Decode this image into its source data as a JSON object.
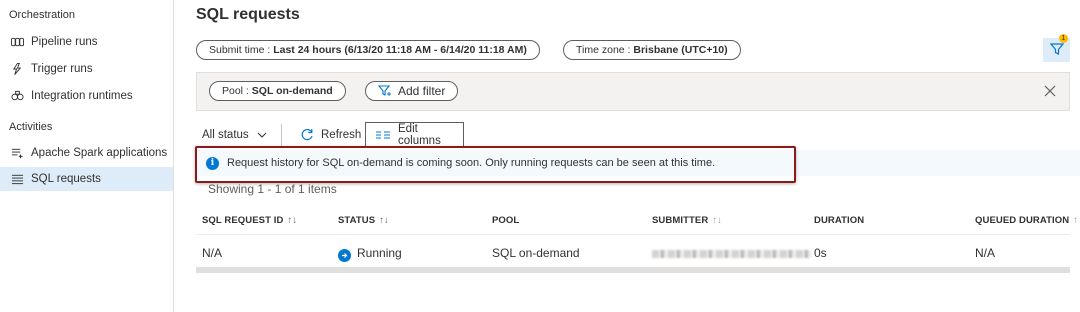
{
  "sidebar": {
    "orchestration_heading": "Orchestration",
    "orchestration_items": [
      {
        "label": "Pipeline runs",
        "icon": "pipeline-icon"
      },
      {
        "label": "Trigger runs",
        "icon": "trigger-icon"
      },
      {
        "label": "Integration runtimes",
        "icon": "integration-runtime-icon"
      }
    ],
    "activities_heading": "Activities",
    "activities_items": [
      {
        "label": "Apache Spark applications",
        "icon": "spark-icon"
      },
      {
        "label": "SQL requests",
        "icon": "sql-requests-icon",
        "active": true
      }
    ]
  },
  "page": {
    "title": "SQL requests"
  },
  "filters": {
    "submit_time_prefix": "Submit time : ",
    "submit_time_value": "Last 24 hours (6/13/20 11:18 AM - 6/14/20 11:18 AM)",
    "time_zone_prefix": "Time zone : ",
    "time_zone_value": "Brisbane (UTC+10)",
    "filter_badge_count": "1",
    "pool_prefix": "Pool : ",
    "pool_value": "SQL on-demand",
    "add_filter_label": "Add filter"
  },
  "toolbar": {
    "status_label": "All status",
    "refresh_label": "Refresh",
    "edit_columns_label": "Edit columns"
  },
  "info": {
    "message": "Request history for SQL on-demand is coming soon. Only running requests can be seen at this time."
  },
  "table": {
    "showing_text": "Showing 1 - 1 of 1 items",
    "columns": [
      "SQL REQUEST ID",
      "STATUS",
      "POOL",
      "SUBMITTER",
      "DURATION",
      "QUEUED DURATION"
    ],
    "rows": [
      {
        "request_id": "N/A",
        "status": "Running",
        "pool": "SQL on-demand",
        "duration": "0s",
        "queued_duration": "N/A"
      }
    ]
  },
  "colors": {
    "accent": "#0078d4",
    "highlight_border": "#8b1a1a",
    "active_bg": "#deecf9"
  }
}
